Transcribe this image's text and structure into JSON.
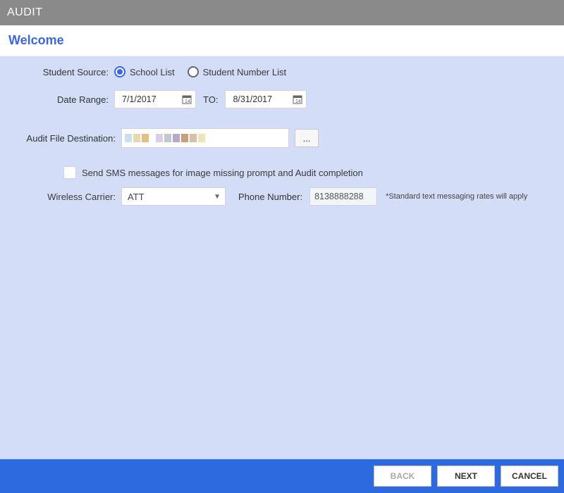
{
  "window": {
    "title": "AUDIT"
  },
  "header": {
    "title": "Welcome"
  },
  "form": {
    "student_source": {
      "label": "Student Source:",
      "option_school": "School List",
      "option_numbers": "Student Number List",
      "selected": "school"
    },
    "date_range": {
      "label": "Date Range:",
      "from": "7/1/2017",
      "to_label": "TO:",
      "to": "8/31/2017"
    },
    "destination": {
      "label": "Audit File Destination:",
      "browse": "..."
    },
    "sms": {
      "checkbox_label": "Send SMS messages for image missing prompt and Audit completion",
      "carrier_label": "Wireless Carrier:",
      "carrier_value": "ATT",
      "phone_label": "Phone Number:",
      "phone_value": "8138888288",
      "disclaimer": "*Standard text messaging rates will apply"
    }
  },
  "footer": {
    "back": "BACK",
    "next": "NEXT",
    "cancel": "CANCEL"
  }
}
